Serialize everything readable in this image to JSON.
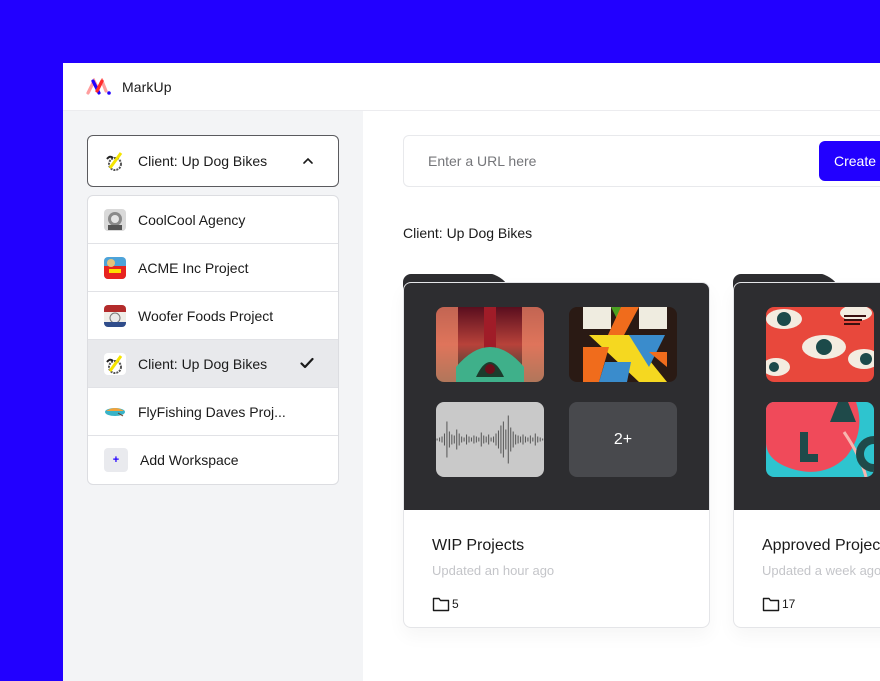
{
  "app": {
    "brand": "MarkUp",
    "accent_color": "#2200ff"
  },
  "workspace_selector": {
    "current": "Client: Up Dog Bikes",
    "expanded": true,
    "items": [
      {
        "label": "CoolCool Agency",
        "icon": "coolcool-avatar",
        "selected": false
      },
      {
        "label": "ACME Inc Project",
        "icon": "acme-avatar",
        "selected": false
      },
      {
        "label": "Woofer Foods Project",
        "icon": "woofer-avatar",
        "selected": false
      },
      {
        "label": "Client: Up Dog Bikes",
        "icon": "updog-avatar",
        "selected": true
      },
      {
        "label": "FlyFishing Daves Proj...",
        "icon": "flyfishing-avatar",
        "selected": false
      },
      {
        "label": "Add Workspace",
        "icon": "plus-icon",
        "selected": false
      }
    ]
  },
  "url_bar": {
    "placeholder": "Enter a URL here",
    "value": "",
    "create_label": "Create"
  },
  "section": {
    "title": "Client: Up Dog Bikes"
  },
  "folders": [
    {
      "name": "WIP Projects",
      "updated": "Updated an hour ago",
      "count": "5",
      "thumbnails": [
        "abstract-symmetric-art",
        "geometric-x-poster",
        "audio-waveform"
      ],
      "more_label": "2+"
    },
    {
      "name": "Approved Projects",
      "updated": "Updated a week ago",
      "count": "17",
      "thumbnails": [
        "eyes-festival-poster",
        "typographic-pink-poster"
      ]
    }
  ]
}
